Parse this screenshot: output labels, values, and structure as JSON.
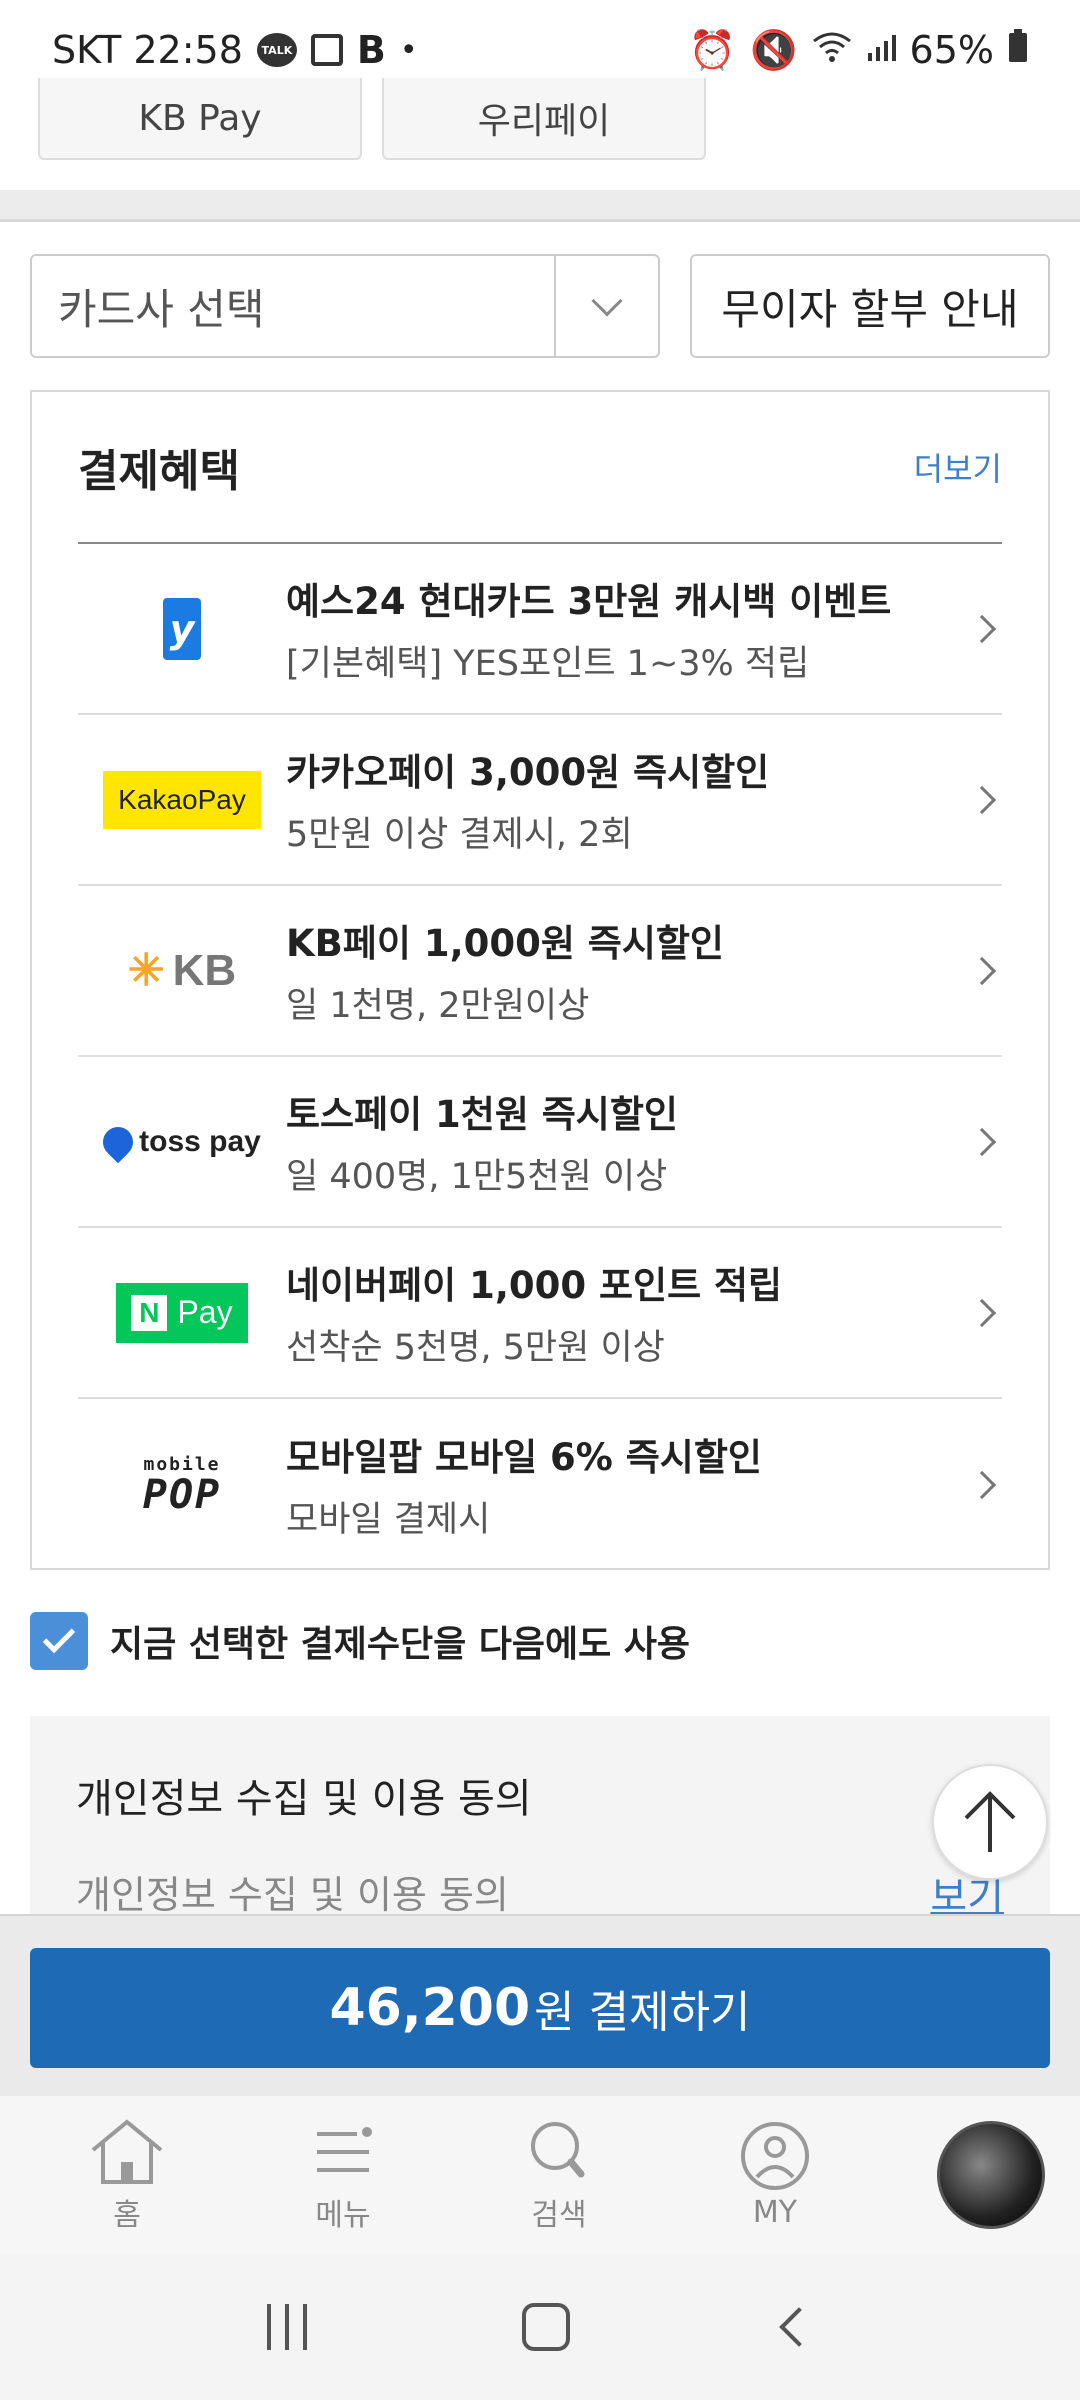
{
  "status_bar": {
    "carrier_time": "SKT 22:58",
    "talk_label": "TALK",
    "b_label": "B",
    "battery": "65%"
  },
  "top_buttons": [
    "KB Pay",
    "우리페이"
  ],
  "card_select": {
    "label": "카드사 선택",
    "installment_button": "무이자 할부 안내"
  },
  "benefits": {
    "title": "결제혜택",
    "more": "더보기",
    "items": [
      {
        "logo": "yes24-hyundai-card-icon",
        "title": "예스24 현대카드 3만원 캐시백 이벤트",
        "sub": "[기본혜택] YES포인트 1~3% 적립"
      },
      {
        "logo": "kakaopay-logo",
        "title": "카카오페이 3,000원 즉시할인",
        "sub": "5만원 이상 결제시, 2회"
      },
      {
        "logo": "kb-logo",
        "title": "KB페이 1,000원 즉시할인",
        "sub": "일 1천명, 2만원이상"
      },
      {
        "logo": "tosspay-logo",
        "title": "토스페이 1천원 즉시할인",
        "sub": "일 400명, 1만5천원 이상"
      },
      {
        "logo": "naverpay-logo",
        "title": "네이버페이 1,000 포인트 적립",
        "sub": "선착순 5천명, 5만원 이상"
      },
      {
        "logo": "mobile-pop-logo",
        "title": "모바일팝 모바일 6% 즉시할인",
        "sub": "모바일 결제시"
      }
    ],
    "logos": {
      "kakao": "KakaoPay",
      "kb": "KB",
      "toss": "toss pay",
      "naver_n": "N",
      "naver_pay": "Pay",
      "pop_top": "mobile",
      "pop_bottom": "POP"
    }
  },
  "save_method": {
    "label": "지금 선택한 결제수단을 다음에도 사용",
    "checked": true
  },
  "privacy": {
    "title": "개인정보 수집 및 이용 동의",
    "sub": "개인정보 수집 및 이용 동의",
    "view": "보기"
  },
  "pay": {
    "amount": "46,200",
    "label": "원 결제하기",
    "color": "#1e6ab5"
  },
  "bottom_nav": [
    {
      "icon": "home-icon",
      "label": "홈"
    },
    {
      "icon": "menu-icon",
      "label": "메뉴"
    },
    {
      "icon": "search-icon",
      "label": "검색"
    },
    {
      "icon": "my-icon",
      "label": "MY"
    }
  ]
}
